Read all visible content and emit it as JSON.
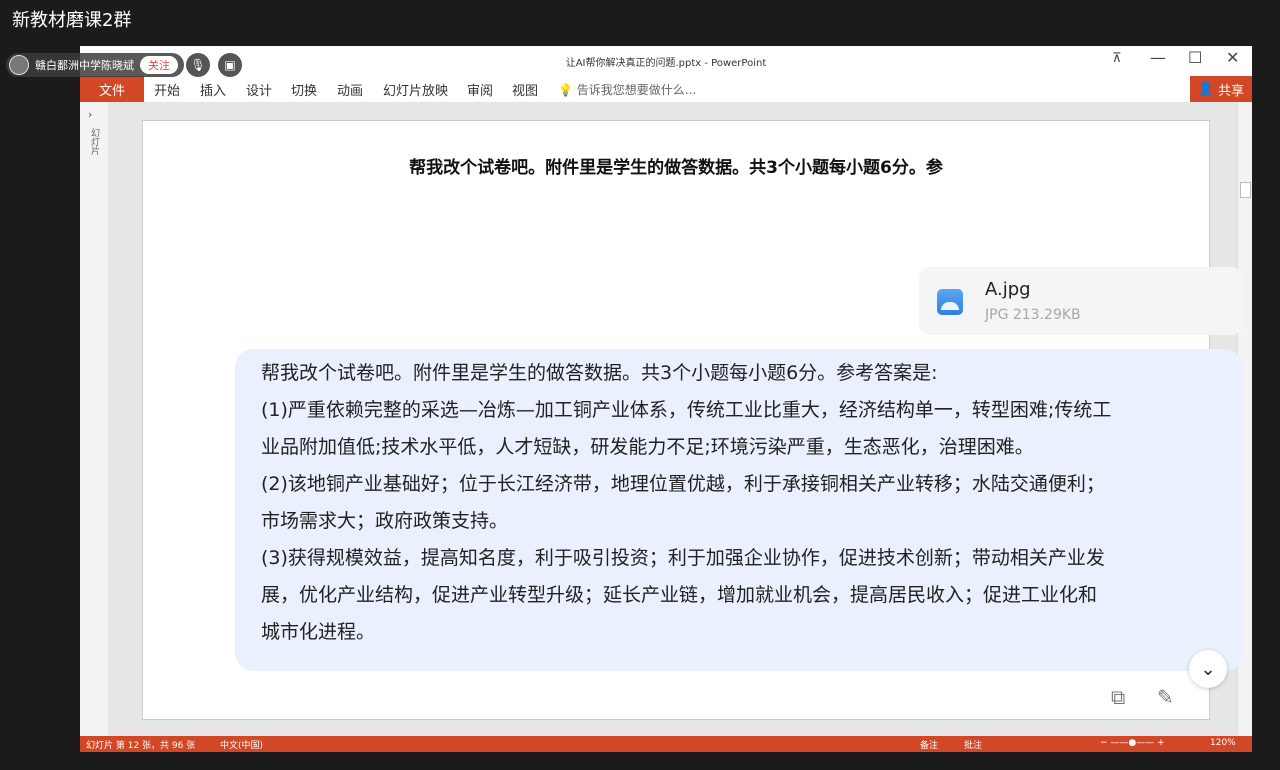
{
  "outer": {
    "title": "新教材磨课2群"
  },
  "presenter": {
    "name": "赣白鄱洲中学陈晓斌",
    "follow_label": "关注"
  },
  "window": {
    "title": "让AI帮你解决真正的问题.pptx - PowerPoint"
  },
  "ribbon": {
    "file_tab": "文件",
    "tabs": [
      "开始",
      "插入",
      "设计",
      "切换",
      "动画",
      "幻灯片放映",
      "审阅",
      "视图"
    ],
    "tell_me": "告诉我您想要做什么...",
    "share": "共享"
  },
  "slide": {
    "heading": "帮我改个试卷吧。附件里是学生的做答数据。共3个小题每小题6分。参",
    "file": {
      "name": "A.jpg",
      "meta": "JPG 213.29KB"
    },
    "message": [
      "帮我改个试卷吧。附件里是学生的做答数据。共3个小题每小题6分。参考答案是:",
      "(1)严重依赖完整的采选—冶炼—加工铜产业体系，传统工业比重大，经济结构单一，转型困难;传统工",
      "业品附加值低;技术水平低，人才短缺，研发能力不足;环境污染严重，生态恶化，治理困难。",
      "(2)该地铜产业基础好；位于长江经济带，地理位置优越，利于承接铜相关产业转移；水陆交通便利；",
      "市场需求大；政府政策支持。",
      "(3)获得规模效益，提高知名度，利于吸引投资；利于加强企业协作，促进技术创新；带动相关产业发",
      "展，优化产业结构，促进产业转型升级；延长产业链，增加就业机会，提高居民收入；促进工业化和",
      "城市化进程。"
    ]
  },
  "status": {
    "slide_info": "幻灯片 第 12 张，共 96 张",
    "language": "中文(中国)",
    "notes": "备注",
    "comments": "批注",
    "zoom": "120%"
  }
}
